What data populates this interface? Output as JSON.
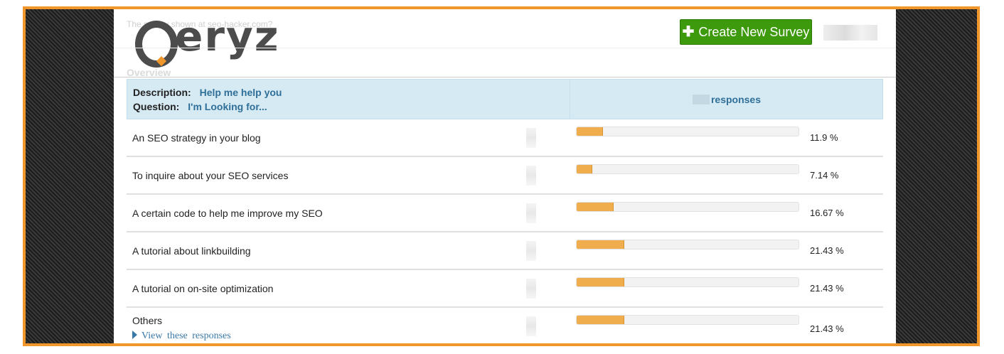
{
  "header": {
    "faded_url": "The survey shown at seo-hacker.com?",
    "logo_text": "eryz",
    "create_button_label": "Create New Survey",
    "create_button_icon": "plus-icon"
  },
  "overview": {
    "title": "Overview"
  },
  "survey": {
    "description_key": "Description:",
    "description_value": "Help me help you",
    "question_key": "Question:",
    "question_value": "I'm Looking for...",
    "responses_label": "responses"
  },
  "answers": [
    {
      "label": "An SEO strategy in your blog",
      "percent_text": "11.9 %",
      "fraction": 0.119
    },
    {
      "label": "To inquire about your SEO services",
      "percent_text": "7.14 %",
      "fraction": 0.0714
    },
    {
      "label": "A certain code to help me improve my SEO",
      "percent_text": "16.67 %",
      "fraction": 0.1667
    },
    {
      "label": "A tutorial about linkbuilding",
      "percent_text": "21.43 %",
      "fraction": 0.2143
    },
    {
      "label": "A tutorial on on-site optimization",
      "percent_text": "21.43 %",
      "fraction": 0.2143
    },
    {
      "label": "Others",
      "percent_text": "21.43 %",
      "fraction": 0.2143,
      "link_label": "View  these  responses"
    }
  ],
  "colors": {
    "accent_orange": "#f0962a",
    "bar_fill": "#f0ad4e",
    "button_green": "#3d9a0c",
    "header_blue_bg": "#d6eaf4",
    "link_blue": "#2f6f98"
  }
}
